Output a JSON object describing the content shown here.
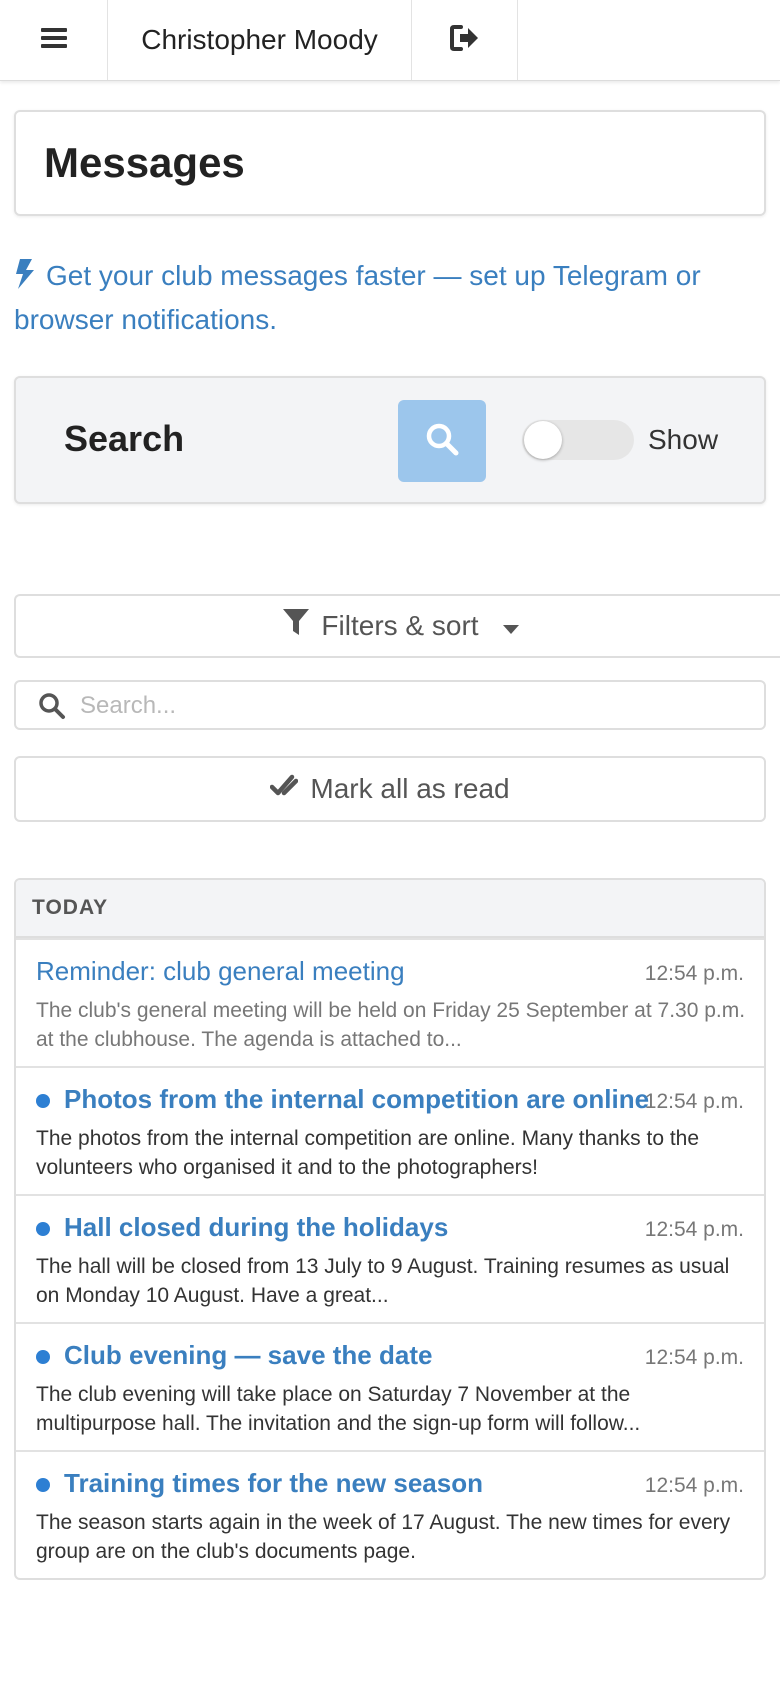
{
  "header": {
    "user_name": "Christopher Moody",
    "menu_icon": "hamburger-menu-icon",
    "logout_icon": "sign-out-icon"
  },
  "page": {
    "title": "Messages"
  },
  "notice": {
    "text": "Get your club messages faster — set up Telegram or browser notifications.",
    "icon": "bolt-icon"
  },
  "search_panel": {
    "label": "Search",
    "toggle_label": "Show",
    "toggle_on": false
  },
  "filters": {
    "label": "Filters & sort"
  },
  "search_field": {
    "placeholder": "Search...",
    "value": ""
  },
  "mark_all": {
    "label": "Mark all as read"
  },
  "list": {
    "section_label": "TODAY",
    "messages": [
      {
        "title": "Reminder: club general meeting",
        "time": "12:54 p.m.",
        "body": "The club's general meeting will be held on Friday 25 September at 7.30 p.m. at the clubhouse. The agenda is attached to...",
        "unread": false
      },
      {
        "title": "Photos from the internal competition are online",
        "time": "12:54 p.m.",
        "body": "The photos from the internal competition are online. Many thanks to the volunteers who organised it and to the photographers!",
        "unread": true
      },
      {
        "title": "Hall closed during the holidays",
        "time": "12:54 p.m.",
        "body": "The hall will be closed from 13 July to 9 August. Training resumes as usual on Monday 10 August. Have a great...",
        "unread": true
      },
      {
        "title": "Club evening — save the date",
        "time": "12:54 p.m.",
        "body": "The club evening will take place on Saturday 7 November at the multipurpose hall. The invitation and the sign-up form will follow...",
        "unread": true
      },
      {
        "title": "Training times for the new season",
        "time": "12:54 p.m.",
        "body": "The season starts again in the week of 17 August. The new times for every group are on the club's documents page.",
        "unread": true
      }
    ]
  },
  "colors": {
    "link": "#3a7fbf",
    "unread_dot": "#2d7fd3",
    "search_button": "#9cc6ec",
    "panel_bg": "#f3f4f6"
  }
}
